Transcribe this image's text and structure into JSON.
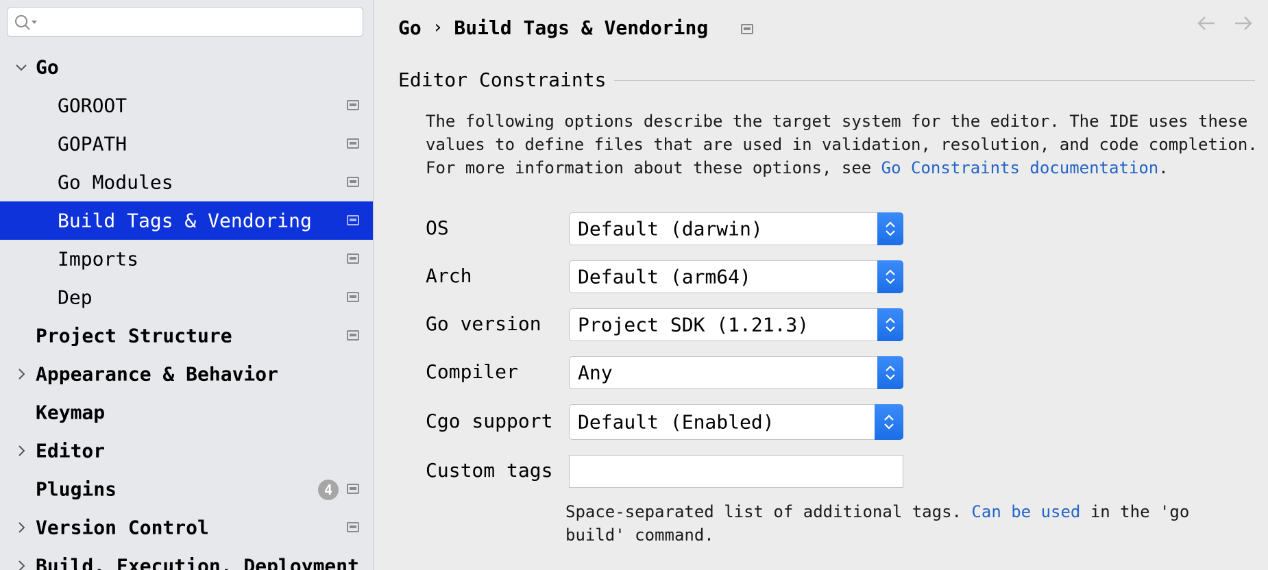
{
  "search": {
    "placeholder": "",
    "value": ""
  },
  "sidebar": {
    "items": [
      {
        "label": "Go",
        "level": 0,
        "expander": "expanded",
        "selected": false,
        "has_project_icon": false
      },
      {
        "label": "GOROOT",
        "level": 1,
        "selected": false,
        "has_project_icon": true
      },
      {
        "label": "GOPATH",
        "level": 1,
        "selected": false,
        "has_project_icon": true
      },
      {
        "label": "Go Modules",
        "level": 1,
        "selected": false,
        "has_project_icon": true
      },
      {
        "label": "Build Tags & Vendoring",
        "level": 1,
        "selected": true,
        "has_project_icon": true
      },
      {
        "label": "Imports",
        "level": 1,
        "selected": false,
        "has_project_icon": true
      },
      {
        "label": "Dep",
        "level": 1,
        "selected": false,
        "has_project_icon": true
      },
      {
        "label": "Project Structure",
        "level": 0,
        "selected": false,
        "has_project_icon": true
      },
      {
        "label": "Appearance & Behavior",
        "level": 0,
        "expander": "collapsed",
        "selected": false,
        "has_project_icon": false
      },
      {
        "label": "Keymap",
        "level": 0,
        "selected": false,
        "has_project_icon": false
      },
      {
        "label": "Editor",
        "level": 0,
        "expander": "collapsed",
        "selected": false,
        "has_project_icon": false
      },
      {
        "label": "Plugins",
        "level": 0,
        "selected": false,
        "has_project_icon": true,
        "badge": "4"
      },
      {
        "label": "Version Control",
        "level": 0,
        "expander": "collapsed",
        "selected": false,
        "has_project_icon": true
      },
      {
        "label": "Build, Execution, Deployment",
        "level": 0,
        "expander": "collapsed",
        "selected": false,
        "has_project_icon": false
      }
    ]
  },
  "breadcrumb": {
    "parent": "Go",
    "separator": "›",
    "current": "Build Tags & Vendoring"
  },
  "nav": {
    "back_icon": "arrow-left-icon",
    "forward_icon": "arrow-right-icon"
  },
  "section": {
    "title": "Editor Constraints",
    "description_pre": "The following options describe the target system for the editor. The IDE uses these values to define files that are used in validation, resolution, and code completion. For more information about these options, see ",
    "description_link": "Go Constraints documentation",
    "description_post": "."
  },
  "form": {
    "os": {
      "label": "OS",
      "value": "Default (darwin)"
    },
    "arch": {
      "label": "Arch",
      "value": "Default (arm64)"
    },
    "go_version": {
      "label": "Go version",
      "value": "Project SDK (1.21.3)"
    },
    "compiler": {
      "label": "Compiler",
      "value": "Any"
    },
    "cgo": {
      "label": "Cgo support",
      "value": "Default (Enabled)"
    },
    "custom_tags": {
      "label": "Custom tags",
      "value": ""
    }
  },
  "hint": {
    "pre": "Space-separated list of additional tags. ",
    "link": "Can be used",
    "post": " in the 'go build' command."
  },
  "colors": {
    "selection": "#0f33da",
    "link": "#2463c7",
    "combo_button": "#1c6ee8"
  }
}
